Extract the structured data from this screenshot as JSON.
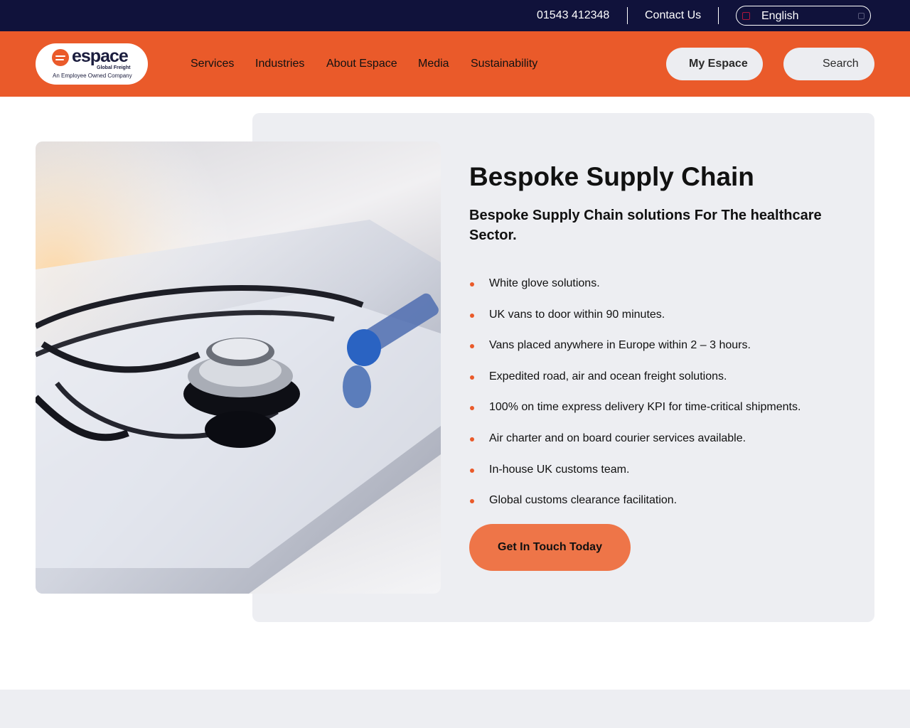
{
  "topbar": {
    "phone": "01543 412348",
    "contact_label": "Contact Us",
    "language": "English"
  },
  "header": {
    "logo": {
      "wordmark": "espace",
      "tagline": "Global Freight",
      "subtitle": "An Employee Owned Company"
    },
    "nav": [
      "Services",
      "Industries",
      "About Espace",
      "Media",
      "Sustainability"
    ],
    "my_espace_label": "My Espace",
    "search_label": "Search"
  },
  "content": {
    "title": "Bespoke Supply Chain",
    "subtitle": "Bespoke Supply Chain solutions For The healthcare Sector.",
    "features": [
      "White glove solutions.",
      "UK vans to door within 90 minutes.",
      "Vans placed anywhere in Europe within 2 – 3 hours.",
      "Expedited road, air and ocean freight solutions.",
      "100% on time express delivery KPI for time-critical shipments.",
      "Air charter and on board courier services available.",
      "In-house UK customs team.",
      "Global customs clearance facilitation."
    ],
    "cta_label": "Get In Touch Today"
  },
  "colors": {
    "topbar_bg": "#10123b",
    "brand_orange": "#ea5a2a",
    "cta_orange": "#ee7548",
    "card_bg": "#edeef2"
  },
  "icons": {
    "logo_mark": "espace-logo-icon",
    "language_flag": "flag-icon",
    "language_caret": "chevron-down-icon",
    "list_bullet": "bullet-dot-icon"
  }
}
